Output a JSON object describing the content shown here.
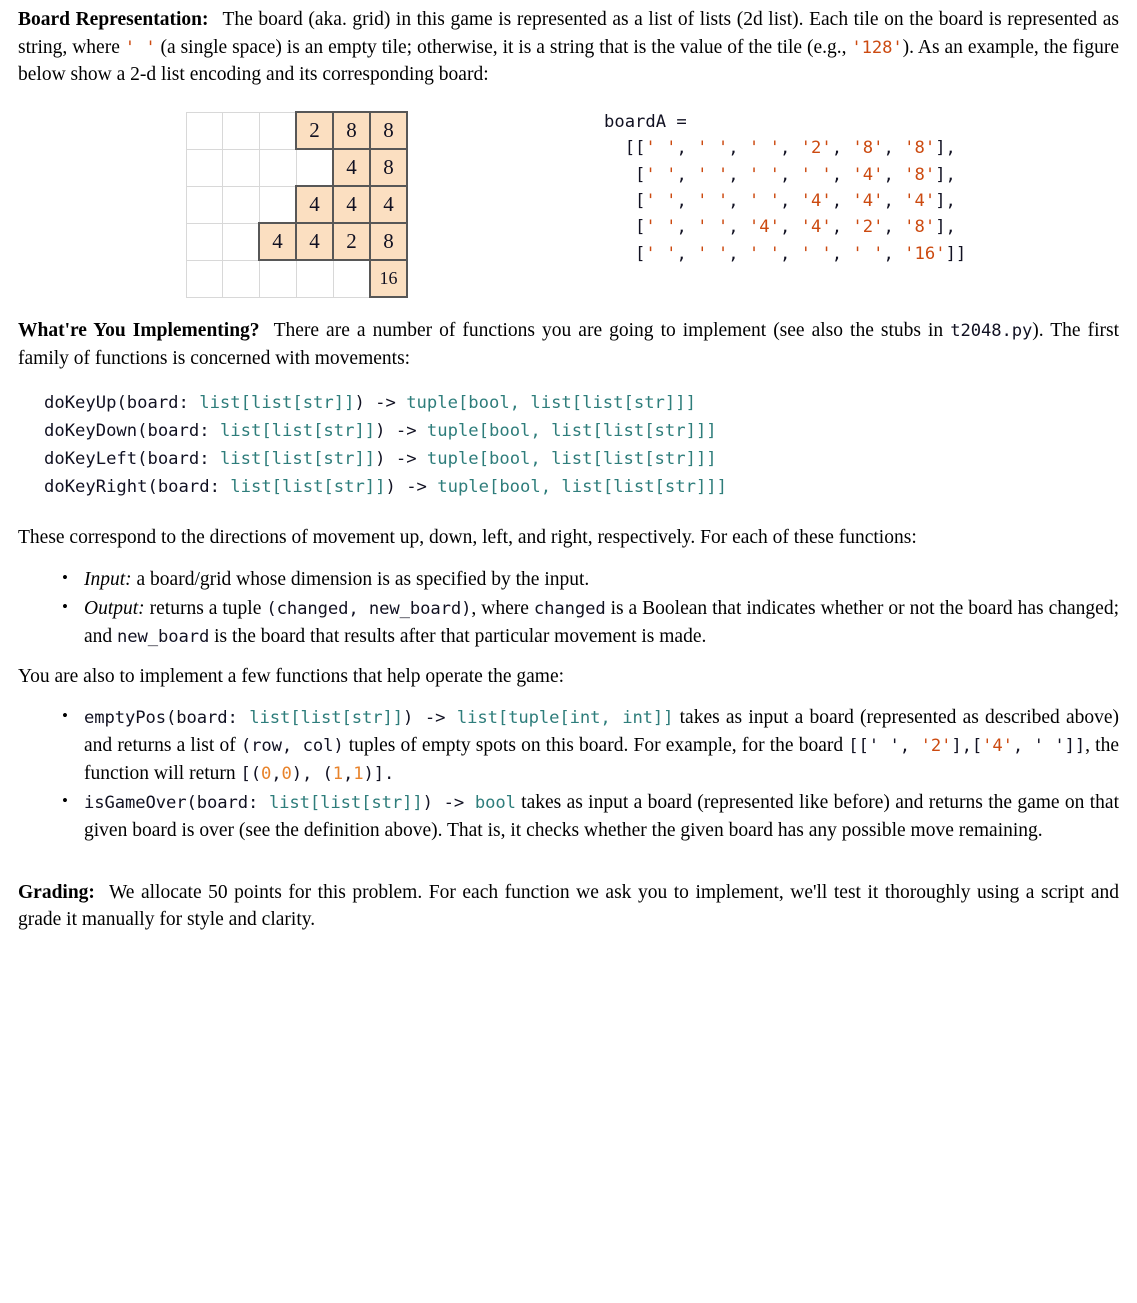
{
  "sections": {
    "board_representation": {
      "lead": "Board Representation:",
      "text_1": "The board (aka. grid) in this game is represented as a list of lists (2d list). Each tile on the board is represented as string, where ",
      "code_empty": "' '",
      "text_2": " (a single space) is an empty tile; otherwise, it is a string that is the value of the tile (e.g., ",
      "code_128": "'128'",
      "text_3": "). As an example, the figure below show a 2-d list encoding and its corresponding board:"
    },
    "implementing": {
      "lead": "What're You Implementing?",
      "text_1": "There are a number of functions you are going to implement (see also the stubs in ",
      "code_file": "t2048.py",
      "text_2": "). The first family of functions is concerned with movements:"
    },
    "correspond": {
      "text": "These correspond to the directions of movement up, down, left, and right, respectively. For each of these functions:"
    },
    "also_implement": {
      "text": "You are also to implement a few functions that help operate the game:"
    },
    "grading": {
      "lead": "Grading:",
      "text": "We allocate 50 points for this problem. For each function we ask you to implement, we'll test it thoroughly using a script and grade it manually for style and clarity."
    }
  },
  "figure": {
    "variable_name": "boardA =",
    "board_rows": [
      [
        " ",
        " ",
        " ",
        "2",
        "8",
        "8"
      ],
      [
        " ",
        " ",
        " ",
        " ",
        "4",
        "8"
      ],
      [
        " ",
        " ",
        " ",
        "4",
        "4",
        "4"
      ],
      [
        " ",
        " ",
        "4",
        "4",
        "2",
        "8"
      ],
      [
        " ",
        " ",
        " ",
        " ",
        " ",
        "16"
      ]
    ],
    "code_lines": [
      "[[' ', ' ', ' ', '2', '8', '8'],",
      " [' ', ' ', ' ', ' ', '4', '8'],",
      " [' ', ' ', ' ', '4', '4', '4'],",
      " [' ', ' ', '4', '4', '2', '8'],",
      " [' ', ' ', ' ', ' ', ' ', '16']]"
    ]
  },
  "signatures": [
    {
      "name": "doKeyUp",
      "params": "(board: ",
      "type_in": "list[list[str]]",
      "arrow": ") -> ",
      "type_out": "tuple[bool, list[list[str]]]"
    },
    {
      "name": "doKeyDown",
      "params": "(board: ",
      "type_in": "list[list[str]]",
      "arrow": ") -> ",
      "type_out": "tuple[bool, list[list[str]]]"
    },
    {
      "name": "doKeyLeft",
      "params": "(board: ",
      "type_in": "list[list[str]]",
      "arrow": ") -> ",
      "type_out": "tuple[bool, list[list[str]]]"
    },
    {
      "name": "doKeyRight",
      "params": "(board: ",
      "type_in": "list[list[str]]",
      "arrow": ") -> ",
      "type_out": "tuple[bool, list[list[str]]]"
    }
  ],
  "io_bullets": {
    "input": {
      "label": "Input:",
      "text": " a board/grid whose dimension is as specified by the input."
    },
    "output": {
      "label": "Output:",
      "text_1": " returns a tuple ",
      "code_1": "(changed, new_board)",
      "text_2": ", where ",
      "code_2": "changed",
      "text_3": " is a Boolean that indicates whether or not the board has changed; and ",
      "code_3": "new_board",
      "text_4": " is the board that results after that particular movement is made."
    }
  },
  "helper_bullets": {
    "empty_pos": {
      "fn": "emptyPos",
      "sig_open": "(board: ",
      "type_in": "list[list[str]]",
      "arrow": ") -> ",
      "type_out": "list[tuple[int, int]]",
      "text_1": " takes as input a board (represented as described above) and returns a list of ",
      "code_rowcol": "(row, col)",
      "text_2": " tuples of empty spots on this board. For example, for the board ",
      "code_board_a": "[[' ', ",
      "code_board_2": "'2'",
      "code_board_b": "],[",
      "code_board_4": "'4'",
      "code_board_c": ", ' ']]",
      "text_3": ", the function will return ",
      "code_ret_a": "[(",
      "code_ret_0a": "0",
      "code_ret_b": ",",
      "code_ret_0b": "0",
      "code_ret_c": "), (",
      "code_ret_1a": "1",
      "code_ret_d": ",",
      "code_ret_1b": "1",
      "code_ret_e": ")].",
      "full_example_board": "[[' ', '2'],['4', ' ']]",
      "full_example_return": "[(0,0), (1,1)]."
    },
    "is_game_over": {
      "fn": "isGameOver",
      "sig_open": "(board: ",
      "type_in": "list[list[str]]",
      "arrow": ") -> ",
      "type_out": "bool",
      "text": " takes as input a board (represented like before) and returns the game on that given board is over (see the definition above). That is, it checks whether the given board has any possible move remaining."
    }
  },
  "colors": {
    "type_teal": "#2e7d7b",
    "string_orange": "#cc4a10",
    "number_orange": "#e8832b",
    "tile_fill": "#fbdfc1",
    "tile_border": "#575757",
    "grid_border": "#d8d8d8",
    "text": "#000000"
  }
}
